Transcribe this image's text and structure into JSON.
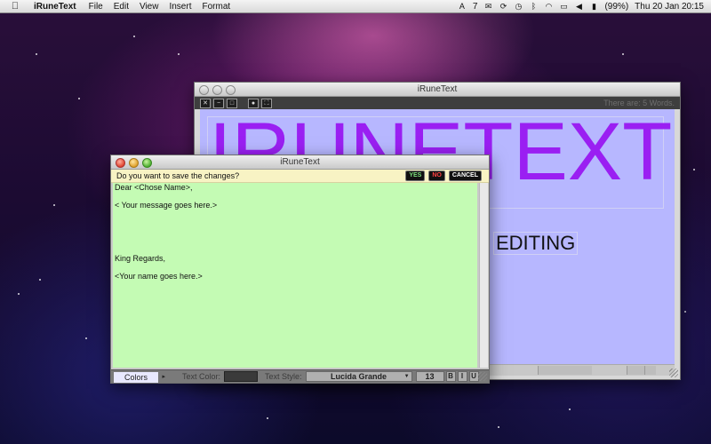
{
  "menubar": {
    "app_name": "iRuneText",
    "items": [
      "File",
      "Edit",
      "View",
      "Insert",
      "Format"
    ],
    "tray_text": "7",
    "battery": "(99%)",
    "clock": "Thu 20 Jan  20:15"
  },
  "back_window": {
    "title": "iRuneText",
    "word_count": "There are: 5 Words.",
    "big_title": "IRUNETEXT",
    "subtitle": "EDITING",
    "canvas_color": "#b7b7ff",
    "title_color": "#9a1ff2"
  },
  "front_window": {
    "title": "iRuneText",
    "save_prompt": "Do you want to save the changes?",
    "yes_label": "YES",
    "no_label": "NO",
    "cancel_label": "CANCEL",
    "editor_color": "#c4fbb4",
    "lines": [
      "Dear <Chose Name>,",
      "< Your message goes here.>",
      "King Regards,",
      "<Your name goes here.>"
    ],
    "bottom": {
      "colors_tab": "Colors",
      "text_color_label": "Text Color:",
      "text_style_label": "Text Style:",
      "font_name": "Lucida Grande",
      "font_size": "13",
      "bold": "B",
      "italic": "I",
      "underline": "U"
    }
  }
}
